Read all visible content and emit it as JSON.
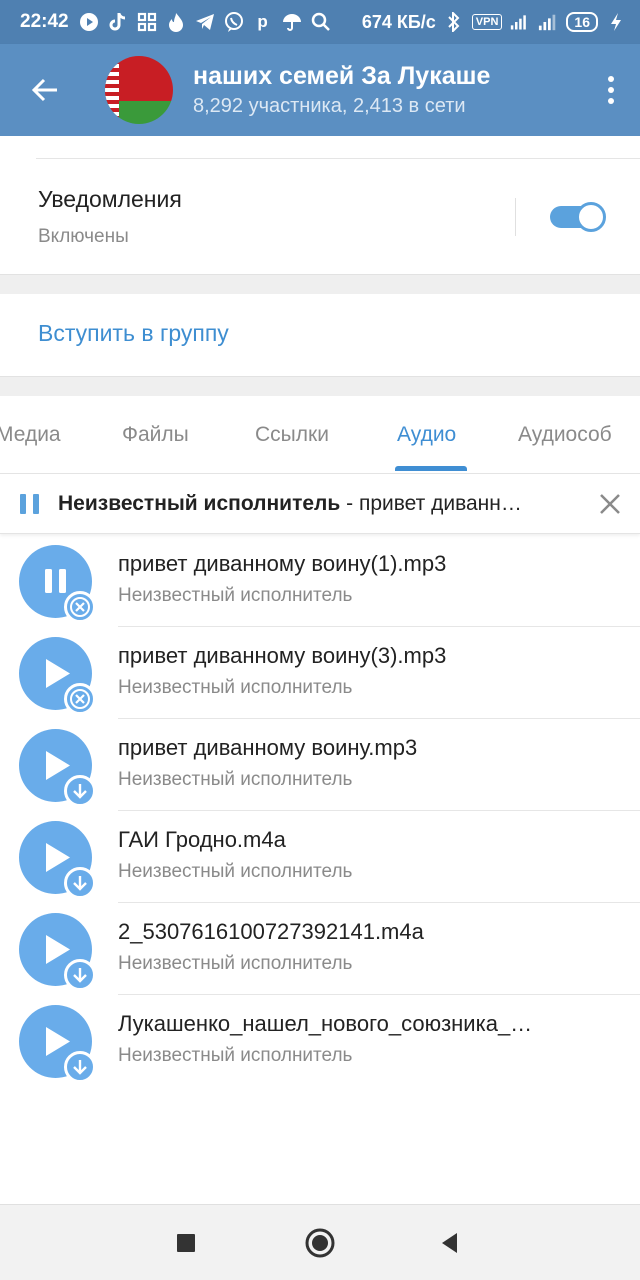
{
  "status_bar": {
    "time": "22:42",
    "speed": "674 КБ/с",
    "vpn": "VPN",
    "battery": "16",
    "icons": [
      "youtube-icon",
      "tiktok-icon",
      "grid-icon",
      "fire-icon",
      "telegram-icon",
      "viber-icon",
      "p-icon",
      "umbrella-icon",
      "search-icon",
      "bluetooth-icon",
      "signal-icon",
      "wifi-icon",
      "charging-icon"
    ]
  },
  "appbar": {
    "title": "наших семей    За Лукаше",
    "subtitle": "8,292 участника, 2,413 в сети"
  },
  "notifications": {
    "title": "Уведомления",
    "status": "Включены",
    "enabled": true
  },
  "join": {
    "label": "Вступить в группу"
  },
  "tabs": [
    {
      "label": "Медиа",
      "active": false
    },
    {
      "label": "Файлы",
      "active": false
    },
    {
      "label": "Ссылки",
      "active": false
    },
    {
      "label": "Аудио",
      "active": true
    },
    {
      "label": "Аудиособ",
      "active": false
    }
  ],
  "player": {
    "artist": "Неизвестный исполнитель",
    "separator": " - ",
    "track": "привет диванн…"
  },
  "audio_list": [
    {
      "title": "привет диванному воину(1).mp3",
      "artist": "Неизвестный исполнитель",
      "state": "playing",
      "badge": "cancel"
    },
    {
      "title": "привет диванному воину(3).mp3",
      "artist": "Неизвестный исполнитель",
      "state": "paused",
      "badge": "cancel"
    },
    {
      "title": "привет диванному воину.mp3",
      "artist": "Неизвестный исполнитель",
      "state": "paused",
      "badge": "download"
    },
    {
      "title": "ГАИ Гродно.m4a",
      "artist": "Неизвестный исполнитель",
      "state": "paused",
      "badge": "download"
    },
    {
      "title": "2_5307616100727392141.m4a",
      "artist": "Неизвестный исполнитель",
      "state": "paused",
      "badge": "download"
    },
    {
      "title": "Лукашенко_нашел_нового_союзника_…",
      "artist": "Неизвестный исполнитель",
      "state": "paused",
      "badge": "download"
    }
  ],
  "colors": {
    "status_bar": "#4f80b1",
    "app_bar": "#5b8fc2",
    "accent": "#3f8ed3",
    "audio_circle": "#69acea"
  }
}
